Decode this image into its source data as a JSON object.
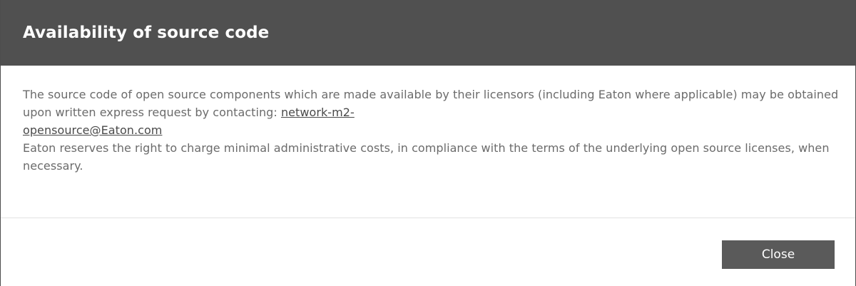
{
  "dialog": {
    "title": "Availability of source code",
    "body_text_1": "The source code of open source components which are made available by their licensors (including Eaton where applicable) may be obtained upon written express request by contacting: ",
    "contact_email_part1": "network-m2-",
    "contact_email_part2": "opensource@Eaton.com",
    "body_text_2": "Eaton reserves the right to charge minimal administrative costs, in compliance with the terms of the underlying open source licenses, when necessary.",
    "close_label": "Close"
  },
  "colors": {
    "header_background": "#505050",
    "button_background": "#5a5a5a",
    "body_text": "#6b6b6b"
  }
}
